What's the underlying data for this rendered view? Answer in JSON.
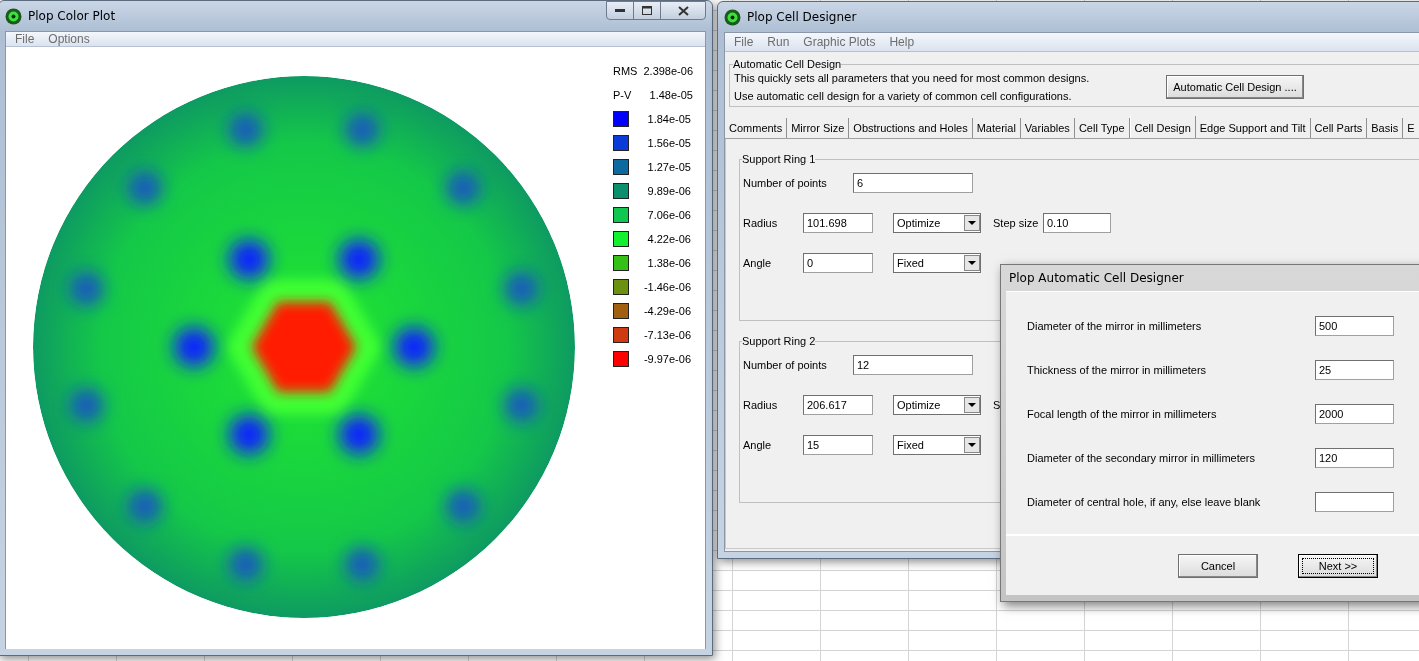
{
  "color_plot_window": {
    "title": "Plop Color Plot",
    "menu": [
      "File",
      "Options"
    ],
    "stats": [
      {
        "label": "RMS",
        "value": "2.398e-06"
      },
      {
        "label": "P-V",
        "value": "1.48e-05"
      }
    ],
    "legend": [
      {
        "value": "1.84e-05",
        "color": "#0000ff"
      },
      {
        "value": "1.56e-05",
        "color": "#0a3ad8"
      },
      {
        "value": "1.27e-05",
        "color": "#0d6a9e"
      },
      {
        "value": "9.89e-06",
        "color": "#0b8f6c"
      },
      {
        "value": "7.06e-06",
        "color": "#10c850"
      },
      {
        "value": "4.22e-06",
        "color": "#12f030"
      },
      {
        "value": "1.38e-06",
        "color": "#34c014"
      },
      {
        "value": "-1.46e-06",
        "color": "#6c9010"
      },
      {
        "value": "-4.29e-06",
        "color": "#a06010"
      },
      {
        "value": "-7.13e-06",
        "color": "#d03a10"
      },
      {
        "value": "-9.97e-06",
        "color": "#ff0000"
      }
    ]
  },
  "cell_designer_window": {
    "title": "Plop Cell Designer",
    "menu": [
      "File",
      "Run",
      "Graphic Plots",
      "Help"
    ],
    "auto_group": {
      "title": "Automatic Cell Design",
      "lines": [
        "This quickly sets all parameters that you need for most common designs.",
        "Use automatic cell design for a variety of common cell configurations."
      ],
      "button": "Automatic Cell Design ...."
    },
    "tabs": [
      {
        "label": "Comments",
        "selected": false
      },
      {
        "label": "Mirror Size",
        "selected": false
      },
      {
        "label": "Obstructions and Holes",
        "selected": false
      },
      {
        "label": "Material",
        "selected": false
      },
      {
        "label": "Variables",
        "selected": false
      },
      {
        "label": "Cell Type",
        "selected": false
      },
      {
        "label": "Cell Design",
        "selected": true
      },
      {
        "label": "Edge Support and Tilt",
        "selected": false
      },
      {
        "label": "Cell Parts",
        "selected": false
      },
      {
        "label": "Basis",
        "selected": false
      },
      {
        "label": "E",
        "selected": false
      }
    ],
    "support_rings": [
      {
        "title": "Support Ring 1",
        "points_label": "Number of points",
        "points": "6",
        "params": [
          {
            "label": "Radius",
            "value": "101.698",
            "mode": "Optimize",
            "step_label": "Step size",
            "step": "0.10"
          },
          {
            "label": "Angle",
            "value": "0",
            "mode": "Fixed"
          }
        ]
      },
      {
        "title": "Support Ring 2",
        "points_label": "Number of points",
        "points": "12",
        "params": [
          {
            "label": "Radius",
            "value": "206.617",
            "mode": "Optimize",
            "step_label": "S"
          },
          {
            "label": "Angle",
            "value": "15",
            "mode": "Fixed"
          }
        ]
      }
    ]
  },
  "dialog": {
    "title": "Plop Automatic Cell Designer",
    "fields": [
      {
        "label": "Diameter of the mirror in millimeters",
        "value": "500"
      },
      {
        "label": "Thickness of the mirror in millimeters",
        "value": "25"
      },
      {
        "label": "Focal length of the mirror in millimeters",
        "value": "2000"
      },
      {
        "label": "Diameter of the secondary mirror in millimeters",
        "value": "120"
      },
      {
        "label": "Diameter of central hole, if any, else leave blank"
      }
    ],
    "buttons": [
      {
        "label": "Cancel",
        "default": false
      },
      {
        "label": "Next >>",
        "default": true
      }
    ]
  }
}
